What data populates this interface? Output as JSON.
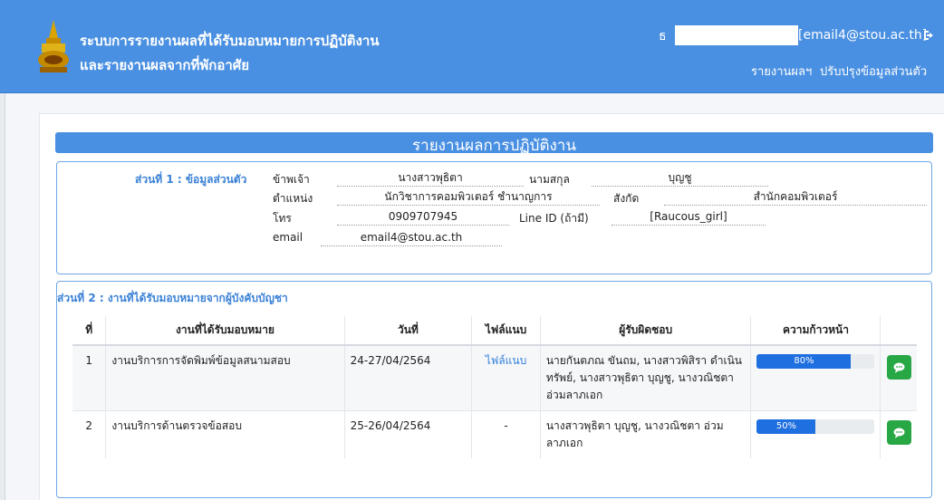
{
  "header": {
    "brand_line1": "ระบบการรายงานผลที่ได้รับมอบหมายการปฏิบัติงาน",
    "brand_line2": "และรายงานผลจากที่พักอาศัย",
    "user_name_initial": "ธ",
    "user_email": "[email4@stou.ac.th]",
    "nav": [
      "รายงานผลฯ",
      "ปรับปรุงข้อมูลส่วนตัว"
    ]
  },
  "page": {
    "title": "รายงานผลการปฏิบัติงาน"
  },
  "section1": {
    "heading": "ส่วนที่ 1 : ข้อมูลส่วนตัว",
    "fields": {
      "prefix_label": "ข้าพเจ้า",
      "prefix_value": "นางสาวพุธิตา",
      "surname_label": "นามสกุล",
      "surname_value": "บุญชู",
      "position_label": "ตำแหน่ง",
      "position_value": "นักวิชาการคอมพิวเตอร์ ชำนาญการ",
      "dept_label": "สังกัด",
      "dept_value": "สำนักคอมพิวเตอร์",
      "tel_label": "โทร",
      "tel_value": "0909707945",
      "line_label": "Line ID (ถ้ามี)",
      "line_value": "[Raucous_girl]",
      "email_label": "email",
      "email_value": "email4@stou.ac.th"
    }
  },
  "section2": {
    "heading": "ส่วนที่ 2 : งานที่ได้รับมอบหมายจากผู้บังคับบัญชา",
    "columns": [
      "ที่",
      "งานที่ได้รับมอบหมาย",
      "วันที่",
      "ไฟล์แนบ",
      "ผู้รับผิดชอบ",
      "ความก้าวหน้า"
    ],
    "rows": [
      {
        "no": "1",
        "task": "งานบริการการจัดพิมพ์ข้อมูลสนามสอบ",
        "date": "24-27/04/2564",
        "file": "ไฟล์แนบ",
        "owners": "นายกันตภณ ขันถม, นางสาวพิสิรา ดำเนินทรัพย์, นางสาวพุธิตา บุญชู, นางวณิชตา อ่วมลาภเอก",
        "progress": 80,
        "progress_label": "80%"
      },
      {
        "no": "2",
        "task": "งานบริการด้านตรวจข้อสอบ",
        "date": "25-26/04/2564",
        "file": "-",
        "owners": "นางสาวพุธิตา บุญชู, นางวณิชตา อ่วม ลาภเอก",
        "progress": 50,
        "progress_label": "50%"
      }
    ]
  },
  "colors": {
    "header_bg": "#4a90e2",
    "accent": "#3b82d6",
    "progress": "#1e6fe0",
    "chat_button": "#28a745"
  }
}
